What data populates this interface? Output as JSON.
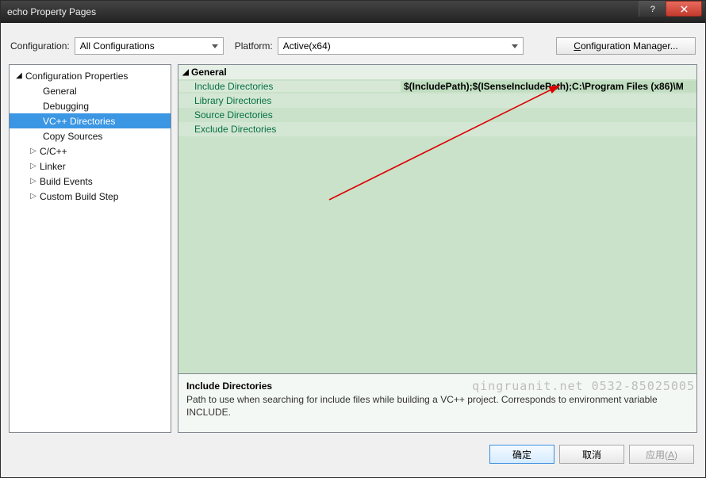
{
  "window": {
    "title": "echo Property Pages"
  },
  "toolbar": {
    "config_label": "Configuration:",
    "config_value": "All Configurations",
    "platform_label": "Platform:",
    "platform_value": "Active(x64)",
    "manager_prefix": "C",
    "manager_rest": "onfiguration Manager..."
  },
  "tree": {
    "root": "Configuration Properties",
    "items": [
      {
        "label": "General"
      },
      {
        "label": "Debugging"
      },
      {
        "label": "VC++ Directories",
        "selected": true
      },
      {
        "label": "Copy Sources"
      },
      {
        "label": "C/C++",
        "expandable": true
      },
      {
        "label": "Linker",
        "expandable": true
      },
      {
        "label": "Build Events",
        "expandable": true
      },
      {
        "label": "Custom Build Step",
        "expandable": true
      }
    ]
  },
  "grid": {
    "group": "General",
    "rows": [
      {
        "name": "Include Directories",
        "value": "$(IncludePath);$(ISenseIncludePath);C:\\Program Files (x86)\\M",
        "selected": true
      },
      {
        "name": "Library Directories",
        "value": ""
      },
      {
        "name": "Source Directories",
        "value": ""
      },
      {
        "name": "Exclude Directories",
        "value": ""
      }
    ]
  },
  "description": {
    "title": "Include Directories",
    "body": "Path to use when searching for include files while building a VC++ project.  Corresponds to environment variable INCLUDE."
  },
  "footer": {
    "ok": "确定",
    "cancel": "取消",
    "apply_prefix": "应用(",
    "apply_u": "A",
    "apply_suffix": ")"
  },
  "watermark": "qingruanit.net 0532-85025005"
}
